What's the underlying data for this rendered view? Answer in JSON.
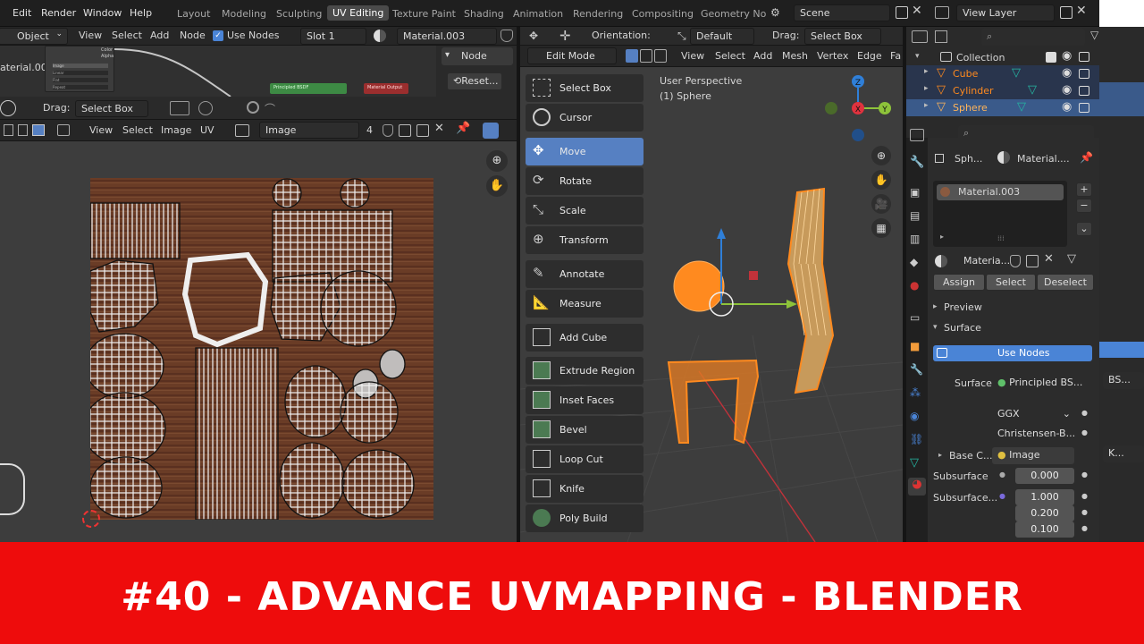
{
  "menus": [
    "Edit",
    "Render",
    "Window",
    "Help"
  ],
  "workspace_tabs": [
    "Layout",
    "Modeling",
    "Sculpting",
    "UV Editing",
    "Texture Paint",
    "Shading",
    "Animation",
    "Rendering",
    "Compositing",
    "Geometry No"
  ],
  "active_tab": "UV Editing",
  "scene": {
    "name": "Scene",
    "view_layer": "View Layer"
  },
  "node_editor": {
    "object_dropdown": "Object",
    "menus": [
      "View",
      "Select",
      "Add",
      "Node"
    ],
    "use_nodes": "Use Nodes",
    "slot": "Slot 1",
    "material": "Material.003",
    "node_tab": "Node",
    "reset": "Reset...",
    "left_label": "aterial.003",
    "node_items": [
      "Color",
      "Alpha"
    ],
    "node_list": [
      "Image",
      "Linear",
      "Flat",
      "Repeat"
    ],
    "bsdf_label": "Principled BSDF",
    "output_label": "Material Output"
  },
  "uv_editor": {
    "drag_label": "Drag:",
    "drag_value": "Select Box",
    "menus": [
      "View",
      "Select",
      "Image",
      "UV"
    ],
    "image_label": "Image",
    "users": "4"
  },
  "viewport": {
    "mode": "Edit Mode",
    "orientation_label": "Orientation:",
    "orientation": "Default",
    "drag_label": "Drag:",
    "drag_value": "Select Box",
    "menus": [
      "View",
      "Select",
      "Add",
      "Mesh",
      "Vertex",
      "Edge",
      "Fa"
    ],
    "overlay_title": "User Perspective",
    "overlay_object": "(1) Sphere",
    "tools": [
      "Select Box",
      "Cursor",
      "Move",
      "Rotate",
      "Scale",
      "Transform",
      "Annotate",
      "Measure",
      "Add Cube",
      "Extrude Region",
      "Inset Faces",
      "Bevel",
      "Loop Cut",
      "Knife",
      "Poly Build"
    ],
    "active_tool": "Move",
    "axis_labels": {
      "x": "X",
      "y": "Y",
      "z": "Z"
    }
  },
  "outliner": {
    "collection": "Collection",
    "items": [
      "Cube",
      "Cylinder",
      "Sphere"
    ],
    "active_item": "Sphere"
  },
  "properties": {
    "breadcrumb_object": "Sph...",
    "breadcrumb_material": "Material....",
    "material_slot": "Material.003",
    "material_name": "Materia...",
    "assign": "Assign",
    "select": "Select",
    "deselect": "Deselect",
    "preview": "Preview",
    "surface_section": "Surface",
    "use_nodes": "Use Nodes",
    "surface_label": "Surface",
    "surface_value": "Principled BS...",
    "distribution": "GGX",
    "subsurface_method": "Christensen-B...",
    "base_color_label": "Base C...",
    "base_color_value": "Image",
    "subsurface_label": "Subsurface",
    "subsurface_value": "0.000",
    "subsurface_radius_label": "Subsurface...",
    "radius_values": [
      "1.000",
      "0.200",
      "0.100"
    ],
    "far_right_values": [
      "BS...",
      "K..."
    ]
  },
  "banner": {
    "text": "#40 - ADVANCE UVMAPPING - BLENDER",
    "color": "#ee0c0c"
  },
  "colors": {
    "active_blue": "#5680c2",
    "selection_orange": "#ff8a1f",
    "axis_x": "#e0323e",
    "axis_y": "#8ec33a",
    "axis_z": "#2f7fd8"
  }
}
